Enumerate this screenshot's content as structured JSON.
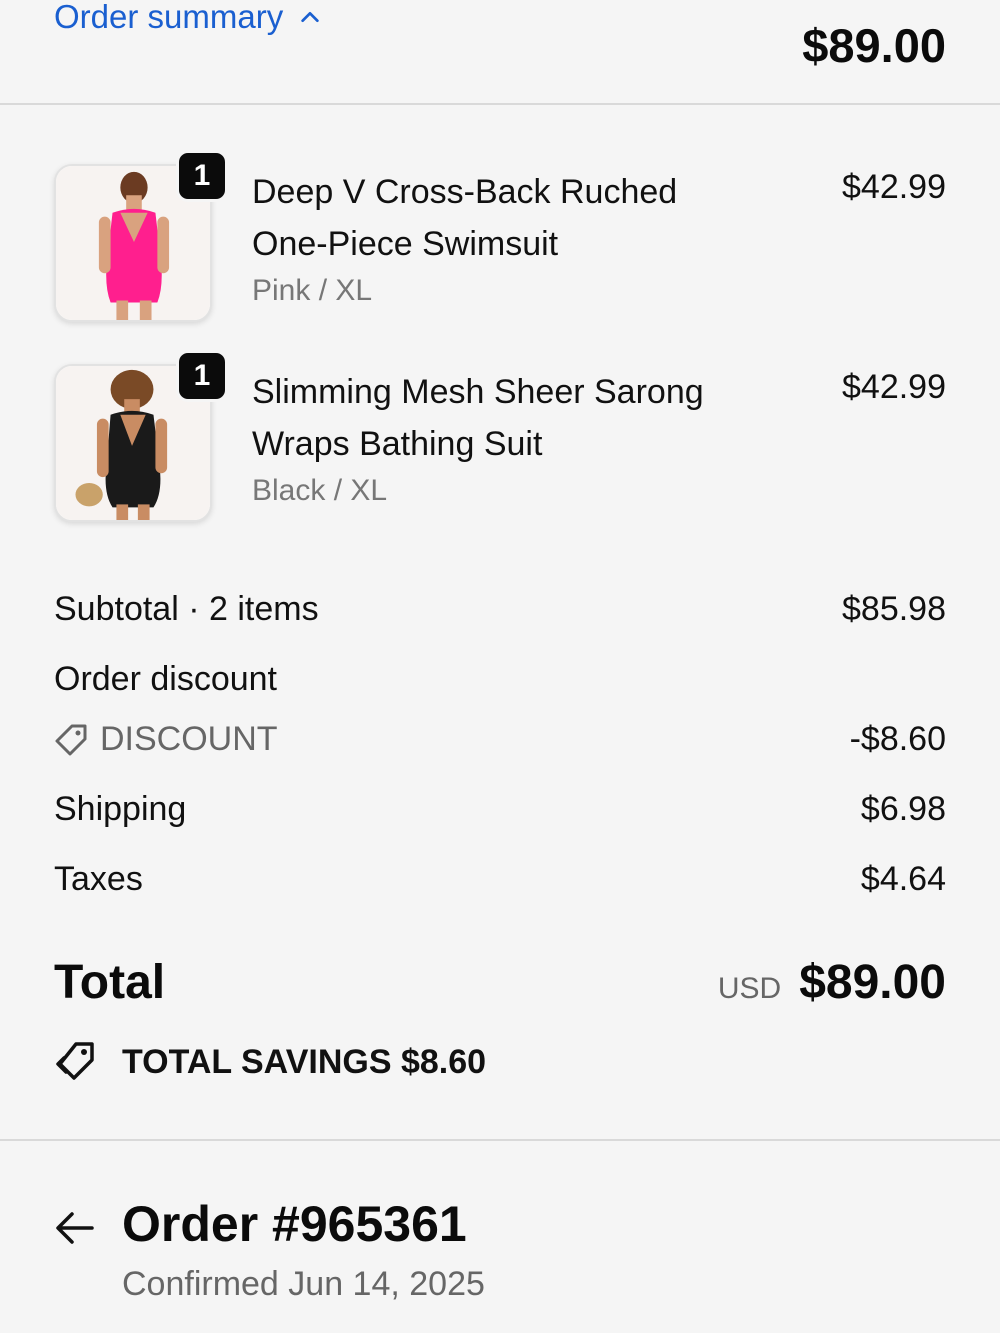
{
  "header": {
    "summary_label": "Order summary",
    "total": "$89.00"
  },
  "items": [
    {
      "quantity": "1",
      "title_line1": "Deep V Cross-Back Ruched",
      "title_line2": "One-Piece Swimsuit",
      "variant": "Pink / XL",
      "price": "$42.99",
      "swatch": "#ff1f8e"
    },
    {
      "quantity": "1",
      "title_line1": "Slimming Mesh Sheer Sarong",
      "title_line2": "Wraps Bathing Suit",
      "variant": "Black / XL",
      "price": "$42.99",
      "swatch": "#1a1a1a"
    }
  ],
  "costs": {
    "subtotal_label": "Subtotal · 2 items",
    "subtotal_value": "$85.98",
    "order_discount_label": "Order discount",
    "discount_code": "DISCOUNT",
    "discount_value": "-$8.60",
    "shipping_label": "Shipping",
    "shipping_value": "$6.98",
    "taxes_label": "Taxes",
    "taxes_value": "$4.64"
  },
  "total": {
    "label": "Total",
    "currency": "USD",
    "amount": "$89.00"
  },
  "savings": {
    "text": "TOTAL SAVINGS $8.60"
  },
  "order": {
    "title": "Order #965361",
    "confirmed": "Confirmed Jun 14, 2025"
  },
  "colors": {
    "accent": "#1a5fd0",
    "background": "#f5f5f5"
  }
}
